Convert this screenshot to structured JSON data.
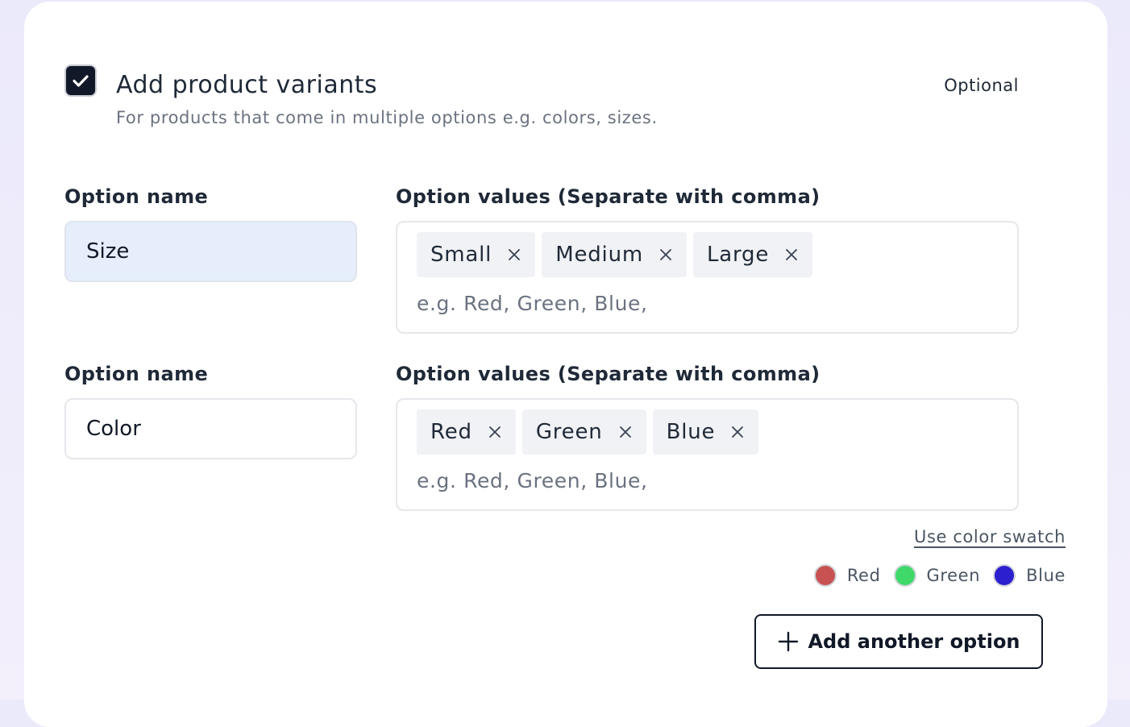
{
  "header": {
    "checked": true,
    "title": "Add product variants",
    "subtitle": "For products that come in multiple options e.g. colors, sizes.",
    "optional_label": "Optional"
  },
  "options": [
    {
      "name_label": "Option name",
      "name_value": "Size",
      "values_label": "Option values (Separate with comma)",
      "values": [
        "Small",
        "Medium",
        "Large"
      ],
      "values_placeholder": "e.g. Red, Green, Blue,"
    },
    {
      "name_label": "Option name",
      "name_value": "Color",
      "values_label": "Option values (Separate with comma)",
      "values": [
        "Red",
        "Green",
        "Blue"
      ],
      "values_placeholder": "e.g. Red, Green, Blue,"
    }
  ],
  "swatch_link": "Use color swatch",
  "swatches": [
    {
      "label": "Red",
      "color": "#c85252"
    },
    {
      "label": "Green",
      "color": "#3fd96a"
    },
    {
      "label": "Blue",
      "color": "#2c1fce"
    }
  ],
  "add_button": {
    "label": "Add another option",
    "icon": "plus-icon"
  },
  "colors": {
    "accent": "#111827",
    "focused_input_bg": "#e6eefc",
    "chip_bg": "#f1f2f5"
  }
}
